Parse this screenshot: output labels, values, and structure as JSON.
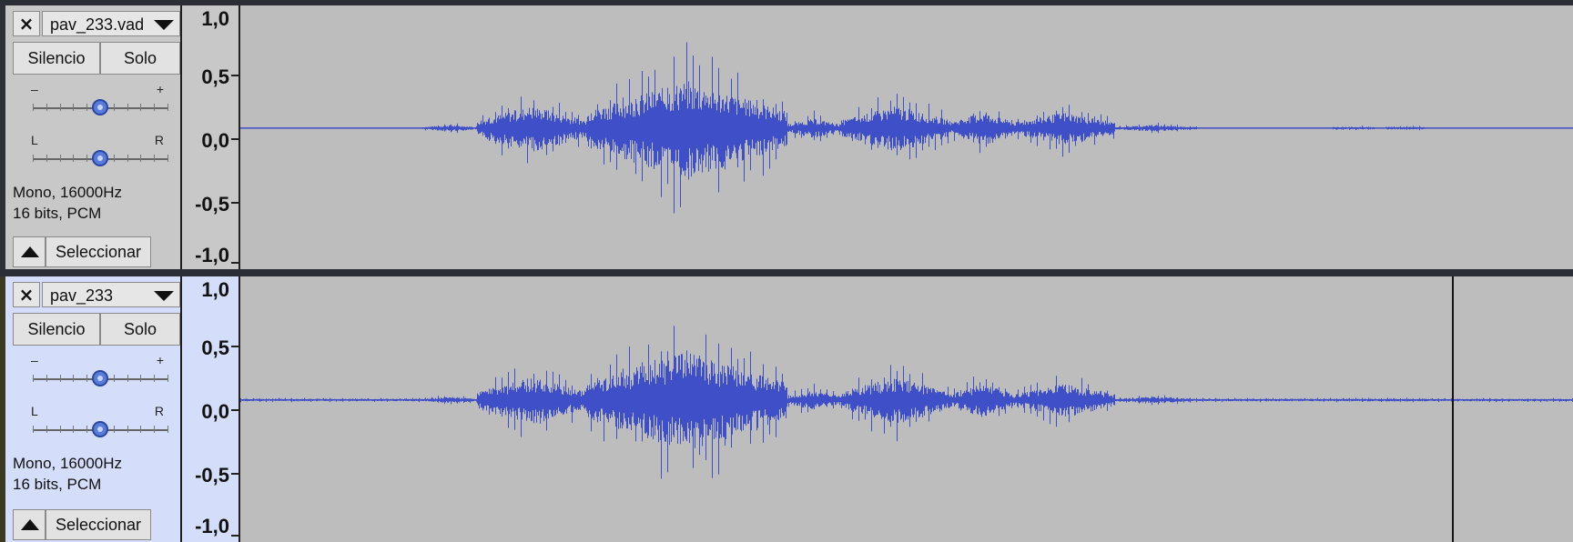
{
  "tracks": [
    {
      "name": "pav_233.vad",
      "mute_label": "Silencio",
      "solo_label": "Solo",
      "gain_minus": "–",
      "gain_plus": "+",
      "gain_value": 0.5,
      "pan_left": "L",
      "pan_right": "R",
      "pan_value": 0.5,
      "info_line1": "Mono, 16000Hz",
      "info_line2": "16 bits, PCM",
      "select_label": "Seleccionar",
      "selected": false,
      "scale_labels": [
        "1,0",
        "0,5",
        "0,0",
        "-0,5",
        "-1,0"
      ],
      "waveform_color": "#3f4fc7"
    },
    {
      "name": "pav_233",
      "mute_label": "Silencio",
      "solo_label": "Solo",
      "gain_minus": "–",
      "gain_plus": "+",
      "gain_value": 0.5,
      "pan_left": "L",
      "pan_right": "R",
      "pan_value": 0.5,
      "info_line1": "Mono, 16000Hz",
      "info_line2": "16 bits, PCM",
      "select_label": "Seleccionar",
      "selected": true,
      "scale_labels": [
        "1,0",
        "0,5",
        "0,0",
        "-0,5",
        "-1,0"
      ],
      "waveform_color": "#3f4fc7",
      "cursor_fraction": 0.909
    }
  ]
}
